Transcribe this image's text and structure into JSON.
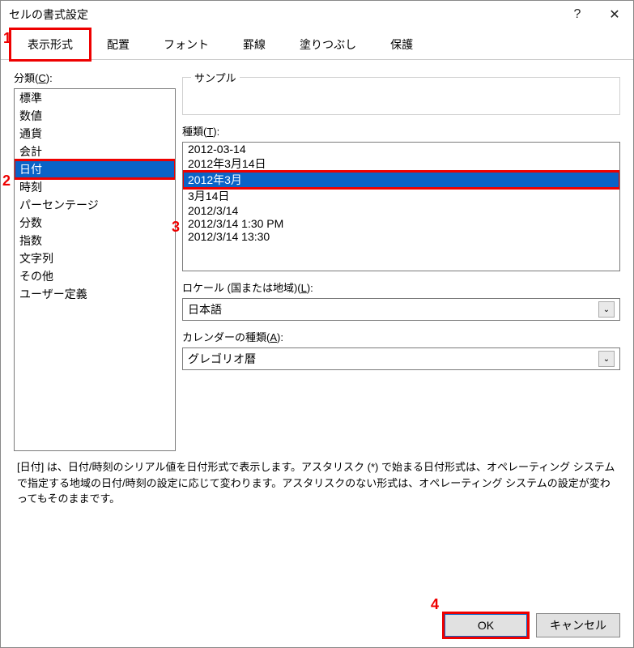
{
  "dialog": {
    "title": "セルの書式設定"
  },
  "titlebar": {
    "help": "?",
    "close": "✕"
  },
  "tabs": [
    {
      "label": "表示形式",
      "active": true
    },
    {
      "label": "配置"
    },
    {
      "label": "フォント"
    },
    {
      "label": "罫線"
    },
    {
      "label": "塗りつぶし"
    },
    {
      "label": "保護"
    }
  ],
  "category": {
    "label_prefix": "分類(",
    "label_u": "C",
    "label_suffix": "):",
    "items": [
      "標準",
      "数値",
      "通貨",
      "会計",
      "日付",
      "時刻",
      "パーセンテージ",
      "分数",
      "指数",
      "文字列",
      "その他",
      "ユーザー定義"
    ],
    "selected": "日付"
  },
  "sample": {
    "label": "サンプル"
  },
  "type": {
    "label_prefix": "種類(",
    "label_u": "T",
    "label_suffix": "):",
    "items": [
      "2012-03-14",
      "2012年3月14日",
      "2012年3月",
      "3月14日",
      "2012/3/14",
      "2012/3/14 1:30 PM",
      "2012/3/14 13:30"
    ],
    "selected": "2012年3月"
  },
  "locale": {
    "label_prefix": "ロケール (国または地域)(",
    "label_u": "L",
    "label_suffix": "):",
    "value": "日本語"
  },
  "calendar": {
    "label_prefix": "カレンダーの種類(",
    "label_u": "A",
    "label_suffix": "):",
    "value": "グレゴリオ暦"
  },
  "description": "[日付] は、日付/時刻のシリアル値を日付形式で表示します。アスタリスク (*) で始まる日付形式は、オペレーティング システムで指定する地域の日付/時刻の設定に応じて変わります。アスタリスクのない形式は、オペレーティング システムの設定が変わってもそのままです。",
  "buttons": {
    "ok": "OK",
    "cancel": "キャンセル"
  },
  "annotations": {
    "n1": "1",
    "n2": "2",
    "n3": "3",
    "n4": "4"
  }
}
